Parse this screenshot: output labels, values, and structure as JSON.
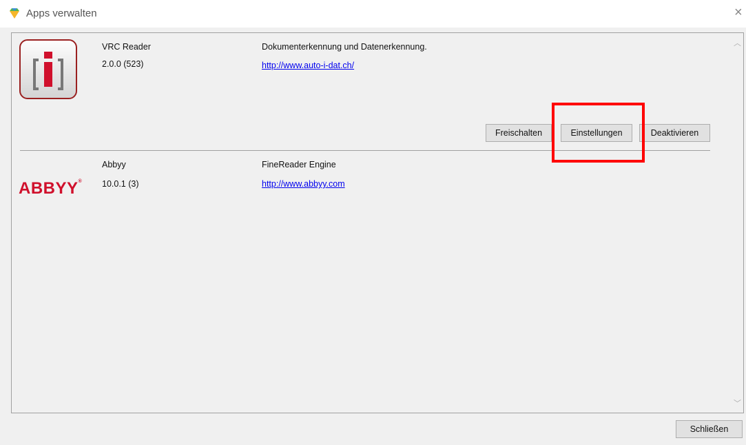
{
  "window": {
    "title": "Apps verwalten",
    "icon": "app-gem-icon",
    "close_glyph": "×"
  },
  "apps": [
    {
      "name": "VRC Reader",
      "version": "2.0.0 (523)",
      "description": "Dokumenterkennung und Datenerkennung.",
      "url": "http://www.auto-i-dat.ch/",
      "logo": "vrc-reader-logo",
      "buttons": {
        "unlock": "Freischalten",
        "settings": "Einstellungen",
        "deactivate": "Deaktivieren"
      }
    },
    {
      "name": "Abbyy",
      "version": "10.0.1 (3)",
      "description": "FineReader Engine",
      "url": "http://www.abbyy.com",
      "logo_text": "ABBYY",
      "logo_mark": "®"
    }
  ],
  "footer": {
    "close_label": "Schließen"
  },
  "colors": {
    "highlight": "#ff0000",
    "abbyy_red": "#d0102c",
    "link": "#0000ee"
  }
}
